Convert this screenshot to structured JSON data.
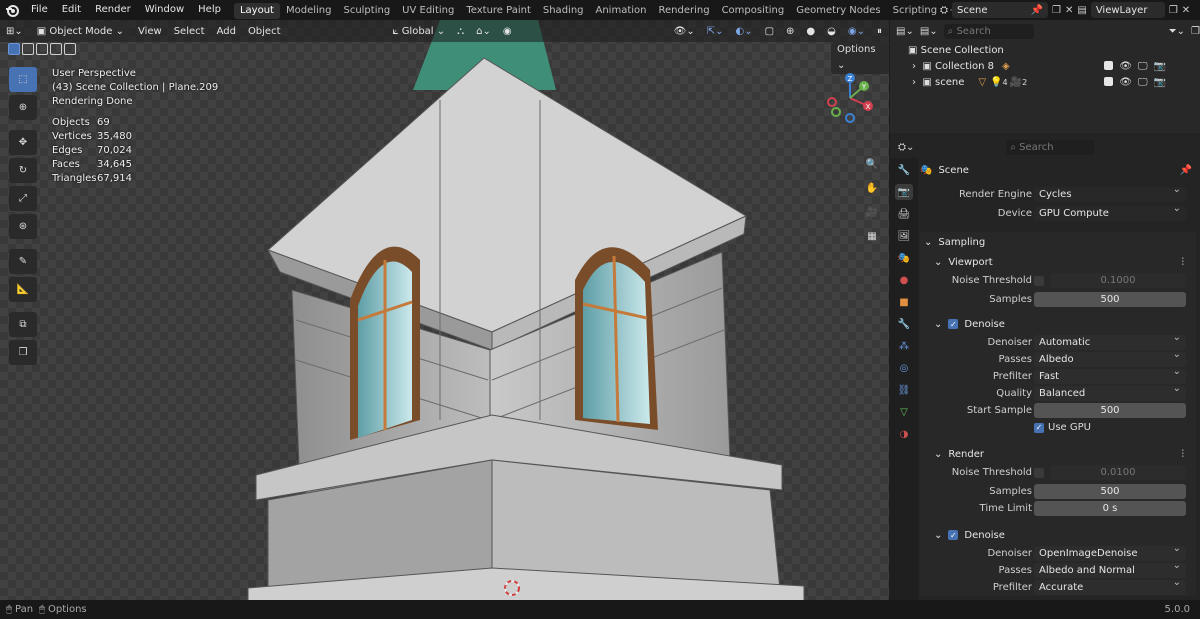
{
  "topbar": {
    "menus": [
      "File",
      "Edit",
      "Render",
      "Window",
      "Help"
    ],
    "workspaces": [
      "Layout",
      "Modeling",
      "Sculpting",
      "UV Editing",
      "Texture Paint",
      "Shading",
      "Animation",
      "Rendering",
      "Compositing",
      "Geometry Nodes",
      "Scripting"
    ],
    "active_workspace": "Layout",
    "add_ws": "+",
    "scene": "Scene",
    "view_layer": "ViewLayer"
  },
  "viewport_header": {
    "mode": "Object Mode",
    "menus": [
      "View",
      "Select",
      "Add",
      "Object"
    ],
    "orientation": "Global",
    "options": "Options"
  },
  "viewport_info": {
    "perspective": "User Perspective",
    "collection": "(43) Scene Collection | Plane.209",
    "status": "Rendering Done"
  },
  "stats": [
    {
      "k": "Objects",
      "v": "69"
    },
    {
      "k": "Vertices",
      "v": "35,480"
    },
    {
      "k": "Edges",
      "v": "70,024"
    },
    {
      "k": "Faces",
      "v": "34,645"
    },
    {
      "k": "Triangles",
      "v": "67,914"
    }
  ],
  "gizmo": {
    "z": "Z",
    "y": "Y",
    "x": "X"
  },
  "outliner": {
    "search": "Search",
    "root": "Scene Collection",
    "items": [
      {
        "label": "Collection 8"
      },
      {
        "label": "scene",
        "count_a": "4",
        "count_b": "2"
      }
    ]
  },
  "properties": {
    "search": "Search",
    "context": "Scene",
    "render_engine_label": "Render Engine",
    "render_engine": "Cycles",
    "device_label": "Device",
    "device": "GPU Compute",
    "sampling": "Sampling",
    "viewport": "Viewport",
    "vp_noise_label": "Noise Threshold",
    "vp_noise": "0.1000",
    "vp_samples_label": "Samples",
    "vp_samples": "500",
    "denoise": "Denoise",
    "denoiser_label": "Denoiser",
    "denoiser": "Automatic",
    "passes_label": "Passes",
    "passes": "Albedo",
    "prefilter_label": "Prefilter",
    "prefilter": "Fast",
    "quality_label": "Quality",
    "quality": "Balanced",
    "start_sample_label": "Start Sample",
    "start_sample": "500",
    "use_gpu": "Use GPU",
    "render": "Render",
    "r_noise_label": "Noise Threshold",
    "r_noise": "0.0100",
    "r_samples_label": "Samples",
    "r_samples": "500",
    "time_limit_label": "Time Limit",
    "time_limit": "0 s",
    "r_denoise": "Denoise",
    "r_denoiser_label": "Denoiser",
    "r_denoiser": "OpenImageDenoise",
    "r_passes_label": "Passes",
    "r_passes": "Albedo and Normal",
    "r_prefilter_label": "Prefilter",
    "r_prefilter": "Accurate"
  },
  "statusbar": {
    "pan": "Pan",
    "options": "Options",
    "version": "5.0.0"
  },
  "colors": {
    "accent": "#4772b3",
    "roof": "#3f8f78",
    "stone": "#a9a9a9",
    "glass": "#9fd1d6",
    "frame": "#c47a3b"
  }
}
